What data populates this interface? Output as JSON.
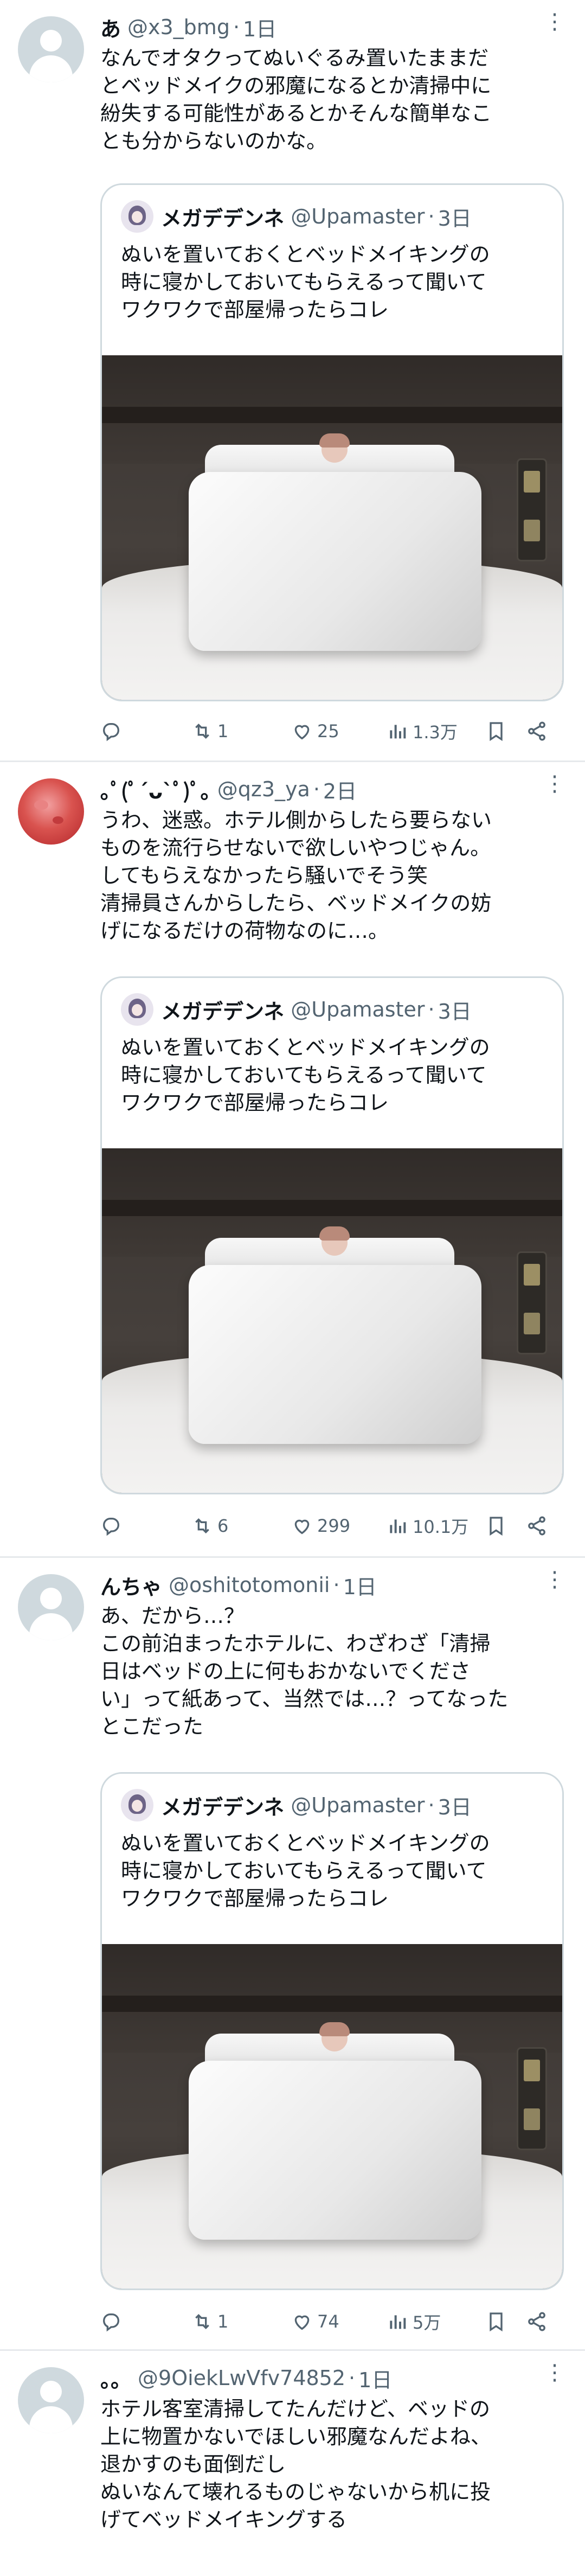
{
  "tweets": [
    {
      "name": "あ",
      "handle": "@x3_bmg",
      "time": "1日",
      "text": "なんでオタクってぬいぐるみ置いたままだ\nとベッドメイクの邪魔になるとか清掃中に\n紛失する可能性があるとかそんな簡単なこ\nとも分からないのかな。",
      "quote": {
        "name": "メガデデンネ",
        "handle": "@Upamaster",
        "time": "3日",
        "text": "ぬいを置いておくとベッドメイキングの\n時に寝かしておいてもらえるって聞いて\nワクワクで部屋帰ったらコレ"
      },
      "stats": {
        "replies": "",
        "retweets": "1",
        "likes": "25",
        "views": "1.3万"
      }
    },
    {
      "name": "｡ﾟ(ﾟ´ᴗ`ﾟ)ﾟ｡",
      "handle": "@qz3_ya",
      "time": "2日",
      "text": "うわ、迷惑。ホテル側からしたら要らない\nものを流行らせないで欲しいやつじゃん。\nしてもらえなかったら騒いでそう笑\n清掃員さんからしたら、ベッドメイクの妨\nげになるだけの荷物なのに…。",
      "quote": {
        "name": "メガデデンネ",
        "handle": "@Upamaster",
        "time": "3日",
        "text": "ぬいを置いておくとベッドメイキングの\n時に寝かしておいてもらえるって聞いて\nワクワクで部屋帰ったらコレ"
      },
      "stats": {
        "replies": "",
        "retweets": "6",
        "likes": "299",
        "views": "10.1万"
      }
    },
    {
      "name": "んちゃ",
      "handle": "@oshitotomonii",
      "time": "1日",
      "text": "あ、だから…？\nこの前泊まったホテルに、わざわざ「清掃\n日はベッドの上に何もおかないでくださ\nい」って紙あって、当然では…？ってなった\nとこだった",
      "quote": {
        "name": "メガデデンネ",
        "handle": "@Upamaster",
        "time": "3日",
        "text": "ぬいを置いておくとベッドメイキングの\n時に寝かしておいてもらえるって聞いて\nワクワクで部屋帰ったらコレ"
      },
      "stats": {
        "replies": "",
        "retweets": "1",
        "likes": "74",
        "views": "5万"
      }
    },
    {
      "name": "。。",
      "handle": "@9OiekLwVfv74852",
      "time": "1日",
      "text": "ホテル客室清掃してたんだけど、ベッドの\n上に物置かないでほしい邪魔なんだよね、\n退かすのも面倒だし\nぬいなんて壊れるものじゃないから机に投\nげてベッドメイキングする"
    }
  ],
  "colors": {
    "text": "#0f1419",
    "secondary": "#536471",
    "border": "#cfd9de",
    "divider": "#e6e9ec"
  },
  "icons": [
    "more-icon",
    "reply-icon",
    "retweet-icon",
    "like-icon",
    "views-icon",
    "bookmark-icon",
    "share-icon"
  ]
}
